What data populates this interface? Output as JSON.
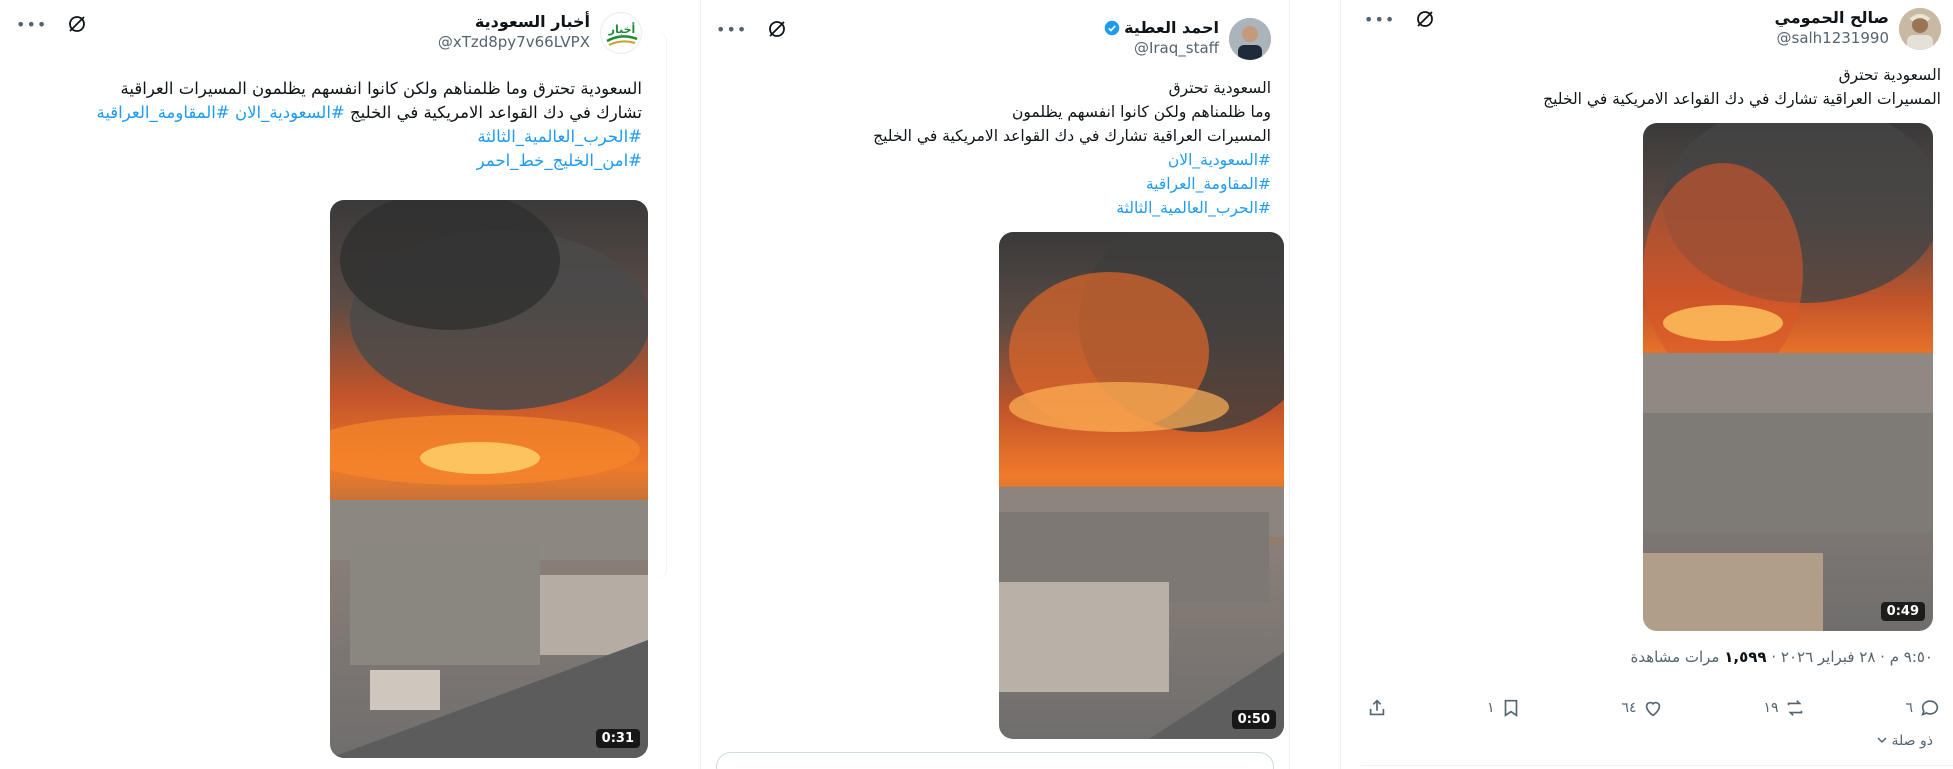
{
  "tweets": [
    {
      "display_name": "أخبار السعودية",
      "handle": "@xTzd8py7v66LVPX",
      "avatar_text": "أخبار",
      "body_lines": [
        "السعودية تحترق وما ظلمناهم ولكن كانوا انفسهم يظلمون المسيرات العراقية",
        "تشارك في دك القواعد الامريكية في الخليج"
      ],
      "inline_hashtags": [
        "#السعودية_الان",
        "#المقاومة_العراقية"
      ],
      "hashtags": [
        "#الحرب_العالمية_الثالثة",
        "#امن_الخليج_خط_احمر"
      ],
      "video_duration": "0:31"
    },
    {
      "display_name": "احمد العطية",
      "handle": "@Iraq_staff",
      "verified": true,
      "body_lines": [
        "السعودية تحترق",
        "وما ظلمناهم ولكن كانوا انفسهم يظلمون",
        "المسيرات العراقية تشارك في دك القواعد الامريكية في الخليج"
      ],
      "hashtags": [
        "#السعودية_الان",
        "#المقاومة_العراقية",
        "#الحرب_العالمية_الثالثة"
      ],
      "video_duration": "0:50"
    },
    {
      "display_name": "صالح الحمومي",
      "handle": "@salh1231990",
      "body_lines": [
        "السعودية تحترق",
        "المسيرات العراقية تشارك في دك القواعد الامريكية في الخليج"
      ],
      "video_duration": "0:49",
      "timestamp": "٩:٥٠ م · ٢٨ فبراير ٢٠٢٦",
      "views_count": "١,٥٩٩",
      "views_label": "مرات مشاهدة",
      "replies": "٦",
      "reposts": "١٩",
      "likes": "٦٤",
      "bookmarks": "١",
      "related_label": "ذو صلة"
    }
  ],
  "icons": {
    "more": "more-icon",
    "grok": "grok-icon",
    "verified": "verified-badge-icon",
    "reply": "reply-icon",
    "repost": "repost-icon",
    "like": "like-icon",
    "bookmark": "bookmark-icon",
    "share": "share-icon",
    "chevron": "chevron-down-icon"
  },
  "colors": {
    "hashtag": "#1d9bf0",
    "verified": "#1d9bf0",
    "secondary_text": "#536471",
    "primary_text": "#0f1419"
  }
}
